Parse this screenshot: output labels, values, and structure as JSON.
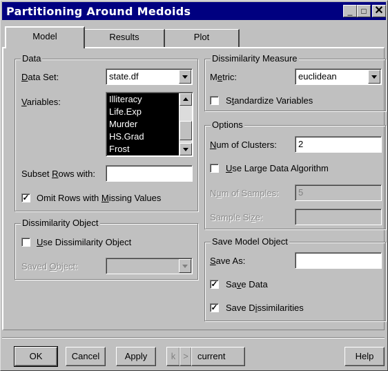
{
  "window": {
    "title": "Partitioning Around Medoids"
  },
  "title_buttons": {
    "minimize": "_",
    "maximize": "□",
    "close": "✕"
  },
  "tabs": {
    "model": "Model",
    "results": "Results",
    "plot": "Plot"
  },
  "data_group": {
    "legend": "Data",
    "dataset_label_u": "D",
    "dataset_label_rest": "ata Set:",
    "dataset_value": "state.df",
    "variables_label_u": "V",
    "variables_label_rest": "ariables:",
    "variables": [
      "Illiteracy",
      "Life.Exp",
      "Murder",
      "HS.Grad",
      "Frost",
      "^"
    ],
    "subset_label_pre": "Subset ",
    "subset_label_u": "R",
    "subset_label_post": "ows with:",
    "subset_value": "",
    "omit_checked": "✓",
    "omit_label_pre": "Omit Rows with ",
    "omit_label_u": "M",
    "omit_label_post": "issing Values"
  },
  "dissim_object_group": {
    "legend": "Dissimilarity Object",
    "use_checked": "",
    "use_label_u": "U",
    "use_label_rest": "se Dissimilarity Object",
    "saved_label_pre": "Saved ",
    "saved_label_u": "O",
    "saved_label_post": "bject:",
    "saved_value": ""
  },
  "dissim_measure_group": {
    "legend": "Dissimilarity Measure",
    "metric_label_pre": "M",
    "metric_label_u": "e",
    "metric_label_post": "tric:",
    "metric_value": "euclidean",
    "standardize_checked": "",
    "standardize_pre": "S",
    "standardize_u": "t",
    "standardize_post": "andardize Variables"
  },
  "options_group": {
    "legend": "Options",
    "clusters_label_u": "N",
    "clusters_label_rest": "um of Clusters:",
    "clusters_value": "2",
    "large_checked": "",
    "large_label_u": "U",
    "large_label_rest": "se Large Data Algorithm",
    "samples_label_pre": "N",
    "samples_label_u": "u",
    "samples_label_post": "m of Samples:",
    "samples_value": "5",
    "size_label_pre": "Sample Si",
    "size_label_u": "z",
    "size_label_post": "e:",
    "size_value": ""
  },
  "save_group": {
    "legend": "Save Model Object",
    "saveas_label_u": "S",
    "saveas_label_rest": "ave As:",
    "saveas_value": "",
    "savedata_checked": "✓",
    "savedata_pre": "Sa",
    "savedata_u": "v",
    "savedata_post": "e Data",
    "savediss_checked": "✓",
    "savediss_pre": "Save D",
    "savediss_u": "i",
    "savediss_post": "ssimilarities"
  },
  "buttons": {
    "ok": "OK",
    "cancel": "Cancel",
    "apply": "Apply",
    "prev": "k",
    "next": ">",
    "current": "current",
    "help": "Help"
  }
}
